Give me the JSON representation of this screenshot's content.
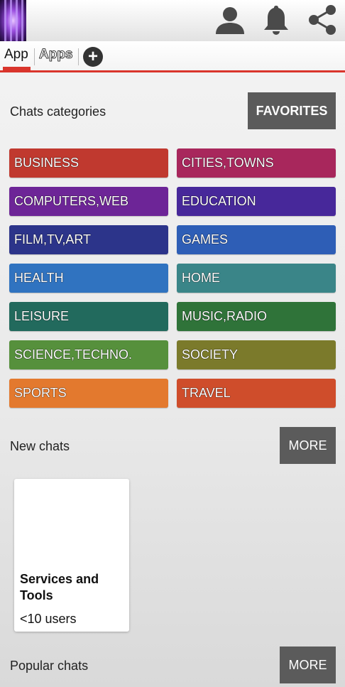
{
  "tabs": {
    "app_label": "App",
    "apps_label": "Apps",
    "add_label": "+"
  },
  "top_icons": [
    "user-icon",
    "bell-icon",
    "share-icon"
  ],
  "categories_section": {
    "label": "Chats categories",
    "favorites_label": "FAVORITES",
    "items": [
      {
        "label": "BUSINESS",
        "color": "#c0392f"
      },
      {
        "label": "CITIES,TOWNS",
        "color": "#a8275c"
      },
      {
        "label": "COMPUTERS,WEB",
        "color": "#6d2597"
      },
      {
        "label": "EDUCATION",
        "color": "#47289a"
      },
      {
        "label": "FILM,TV,ART",
        "color": "#2c348a"
      },
      {
        "label": "GAMES",
        "color": "#2e5eb6"
      },
      {
        "label": "HEALTH",
        "color": "#3073c0"
      },
      {
        "label": "HOME",
        "color": "#3a8588"
      },
      {
        "label": "LEISURE",
        "color": "#226a5d"
      },
      {
        "label": "MUSIC,RADIO",
        "color": "#2f7339"
      },
      {
        "label": "SCIENCE,TECHNO.",
        "color": "#56903c"
      },
      {
        "label": "SOCIETY",
        "color": "#7b7a2b"
      },
      {
        "label": "SPORTS",
        "color": "#e3792e"
      },
      {
        "label": "TRAVEL",
        "color": "#cf4d2b"
      }
    ]
  },
  "new_chats": {
    "label": "New chats",
    "more_label": "MORE",
    "cards": [
      {
        "title": "Services and Tools",
        "users": "<10 users"
      }
    ]
  },
  "popular_chats": {
    "label": "Popular chats",
    "more_label": "MORE"
  },
  "colors": {
    "accent": "#d9352c",
    "button_gray": "#5b5b5b"
  }
}
